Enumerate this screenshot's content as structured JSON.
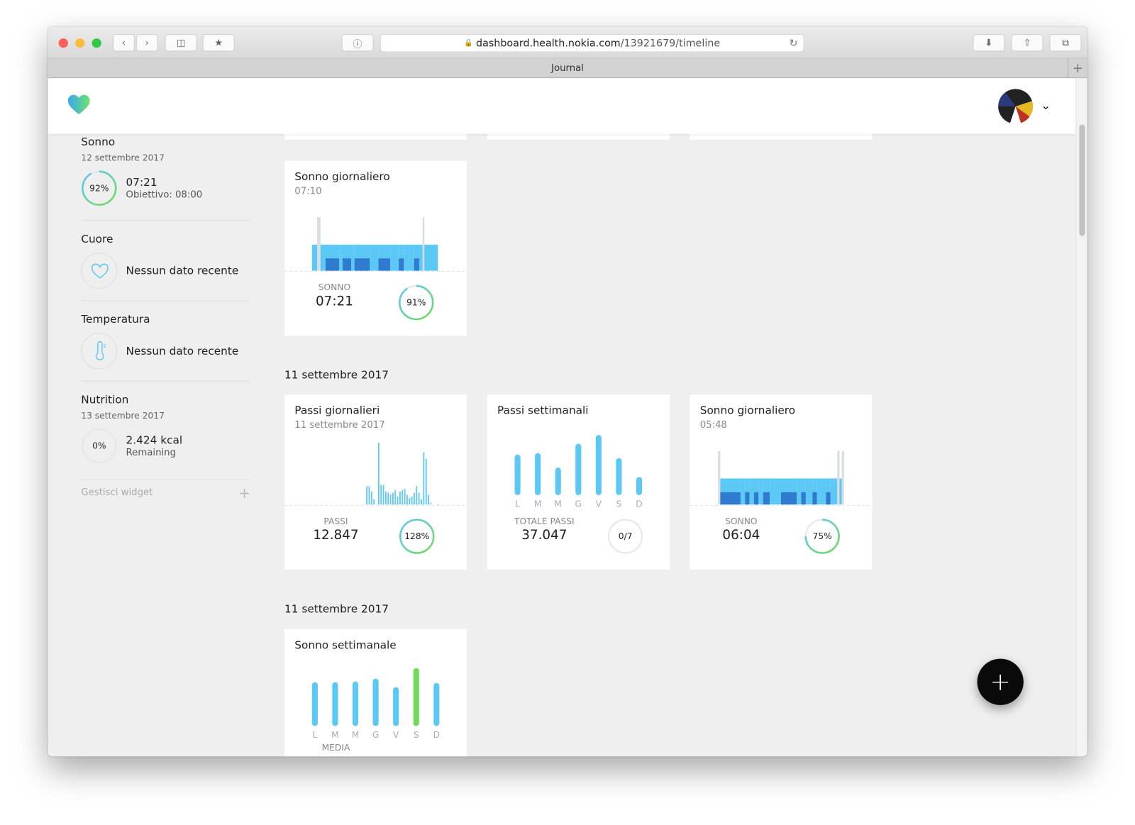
{
  "browser": {
    "url_host": "dashboard.health.nokia.com",
    "url_path": "/13921679/timeline",
    "tab_title": "Journal",
    "new_tab": "+"
  },
  "colors": {
    "accent": "#5bc8f5",
    "deep": "#2f7bd0",
    "awake": "#d8dde2",
    "green": "#6fdc5a",
    "ring_bg": "#e6e6e6"
  },
  "sidebar": {
    "sleep": {
      "title": "Sonno",
      "date": "12 settembre 2017",
      "percent": 92,
      "percent_label": "92%",
      "value": "07:21",
      "goal": "Obiettivo: 08:00"
    },
    "heart": {
      "title": "Cuore",
      "text": "Nessun dato recente"
    },
    "temperature": {
      "title": "Temperatura",
      "text": "Nessun dato recente"
    },
    "nutrition": {
      "title": "Nutrition",
      "date": "13 settembre 2017",
      "percent": 0,
      "percent_label": "0%",
      "value": "2.424 kcal",
      "sub": "Remaining"
    },
    "manage_widgets": "Gestisci widget",
    "add_icon": "+"
  },
  "sections": [
    "11 settembre 2017",
    "11 settembre 2017"
  ],
  "cards": {
    "sleep1": {
      "title": "Sonno giornaliero",
      "subtitle": "07:10",
      "label": "SONNO",
      "value": "07:21",
      "percent": 91,
      "percent_label": "91%",
      "stages": [
        [
          "light",
          3
        ],
        [
          "awake",
          2
        ],
        [
          "light",
          3
        ],
        [
          "deep",
          8
        ],
        [
          "light",
          2
        ],
        [
          "deep",
          5
        ],
        [
          "light",
          2
        ],
        [
          "deep",
          9
        ],
        [
          "light",
          5
        ],
        [
          "deep",
          7
        ],
        [
          "light",
          5
        ],
        [
          "deep",
          3
        ],
        [
          "light",
          6
        ],
        [
          "deep",
          3
        ],
        [
          "light",
          2
        ],
        [
          "awake",
          1
        ],
        [
          "light",
          8
        ]
      ]
    },
    "steps_daily": {
      "title": "Passi giornalieri",
      "subtitle": "11 settembre 2017",
      "label": "PASSI",
      "value": "12.847",
      "percent": 100,
      "percent_label": "128%",
      "values": [
        0,
        0,
        0,
        0,
        0,
        0,
        0,
        0,
        0,
        0,
        0,
        0,
        0,
        0,
        0,
        0,
        0,
        0,
        0,
        0,
        0,
        0,
        0,
        0,
        0,
        0,
        0,
        0,
        0,
        0,
        0,
        0,
        28,
        28,
        20,
        8,
        0,
        95,
        30,
        30,
        20,
        18,
        15,
        18,
        22,
        12,
        20,
        22,
        24,
        15,
        10,
        12,
        18,
        28,
        18,
        8,
        80,
        70,
        15,
        3,
        0,
        0,
        1,
        0,
        0,
        0,
        0,
        0,
        0,
        0,
        0,
        0
      ]
    },
    "steps_weekly": {
      "title": "Passi settimanali",
      "label": "TOTALE PASSI",
      "value": "37.047",
      "progress_label": "0/7",
      "progress": 0,
      "days": [
        "L",
        "M",
        "M",
        "G",
        "V",
        "S",
        "D"
      ],
      "values": [
        5600,
        5800,
        3800,
        7100,
        8300,
        5100,
        2500
      ]
    },
    "sleep2": {
      "title": "Sonno giornaliero",
      "subtitle": "05:48",
      "label": "SONNO",
      "value": "06:04",
      "percent": 75,
      "percent_label": "75%",
      "stages": [
        [
          "awake",
          1
        ],
        [
          "deep",
          9
        ],
        [
          "light",
          2
        ],
        [
          "deep",
          2
        ],
        [
          "light",
          2
        ],
        [
          "deep",
          2
        ],
        [
          "light",
          2
        ],
        [
          "deep",
          3
        ],
        [
          "light",
          5
        ],
        [
          "deep",
          7
        ],
        [
          "light",
          2
        ],
        [
          "deep",
          2
        ],
        [
          "light",
          3
        ],
        [
          "deep",
          2
        ],
        [
          "light",
          4
        ],
        [
          "deep",
          2
        ],
        [
          "light",
          3
        ],
        [
          "awake",
          1
        ],
        [
          "light",
          1
        ],
        [
          "awake",
          1
        ]
      ]
    },
    "sleep_weekly": {
      "title": "Sonno settimanale",
      "label": "MEDIA",
      "days": [
        "L",
        "M",
        "M",
        "G",
        "V",
        "S",
        "D"
      ],
      "values": [
        62,
        62,
        63,
        67,
        55,
        82,
        61
      ],
      "highlight": 5
    }
  },
  "fab": "+"
}
